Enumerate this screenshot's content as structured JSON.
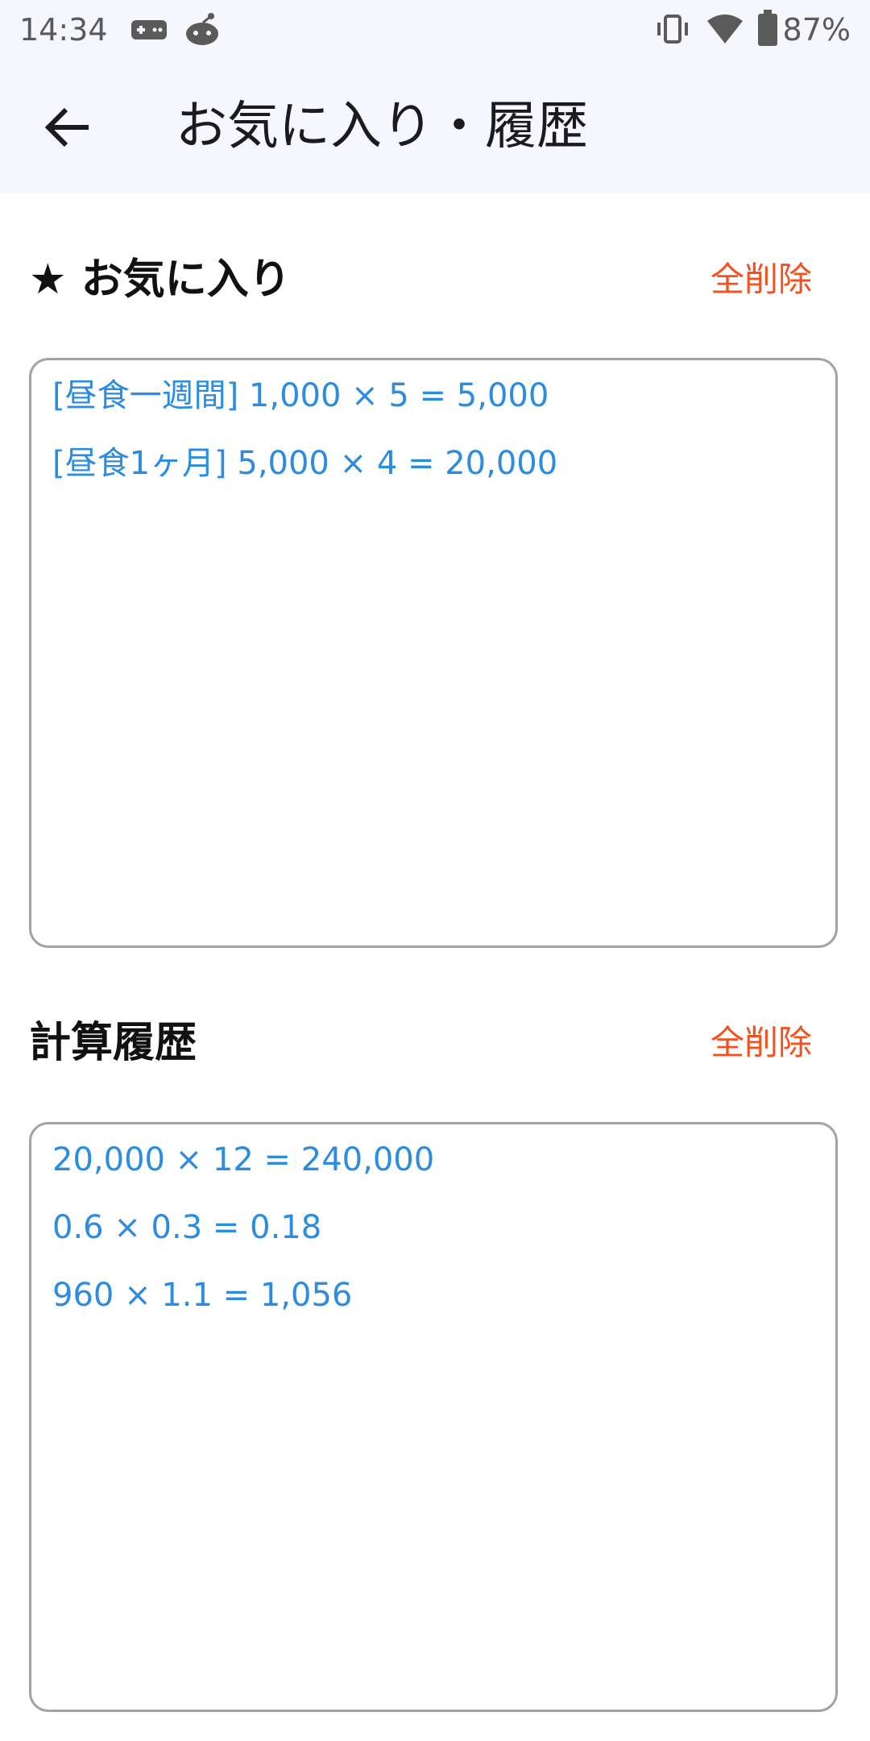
{
  "status_bar": {
    "time": "14:34",
    "battery": "87%",
    "icons": [
      "gamepad-icon",
      "reddit-icon",
      "vibrate-icon",
      "wifi-icon",
      "battery-icon"
    ]
  },
  "app_bar": {
    "title": "お気に入り・履歴",
    "back_icon": "arrow-back-icon"
  },
  "favorites": {
    "title": "★ お気に入り",
    "clear_label": "全削除",
    "items": [
      "[昼食一週間] 1,000 × 5 = 5,000",
      "[昼食1ヶ月] 5,000 × 4 = 20,000"
    ]
  },
  "history": {
    "title": "計算履歴",
    "clear_label": "全削除",
    "items": [
      "20,000 × 12 = 240,000",
      "0.6 × 0.3 = 0.18",
      "960 × 1.1 = 1,056"
    ]
  },
  "colors": {
    "accent": "#f4511e",
    "item_text": "#2b8ce0",
    "app_bar_bg": "#f6f7fc",
    "border": "#a3a3a3"
  }
}
